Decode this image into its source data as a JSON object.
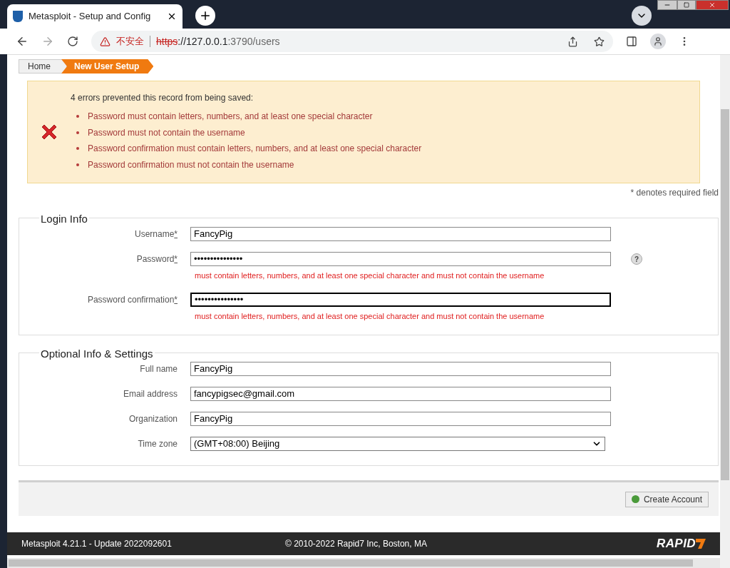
{
  "browser": {
    "tab_title": "Metasploit - Setup and Config",
    "url_warning": "不安全",
    "url_scheme": "https",
    "url_host": "://127.0.0.1",
    "url_path": ":3790/users"
  },
  "breadcrumbs": [
    {
      "label": "Home",
      "selected": false
    },
    {
      "label": "New User Setup",
      "selected": true
    }
  ],
  "error_box": {
    "heading": "4 errors prevented this record from being saved:",
    "errors": [
      "Password must contain letters, numbers, and at least one special character",
      "Password must not contain the username",
      "Password confirmation must contain letters, numbers, and at least one special character",
      "Password confirmation must not contain the username"
    ]
  },
  "required_note": "* denotes required field",
  "sections": [
    {
      "title": "Login Info",
      "fields": [
        {
          "label": "Username",
          "required": "*",
          "value": "FancyPig",
          "kind": "text"
        },
        {
          "label": "Password",
          "required": "*",
          "value": "•••••••••••••••",
          "kind": "text",
          "help": "?",
          "error": "must contain letters, numbers, and at least one special character and must not contain the username"
        },
        {
          "label": "Password confirmation",
          "required": "*",
          "value": "•••••••••••••••",
          "kind": "text",
          "focused": true,
          "error": "must contain letters, numbers, and at least one special character and must not contain the username"
        }
      ]
    },
    {
      "title": "Optional Info & Settings",
      "fields": [
        {
          "label": "Full name",
          "value": "FancyPig",
          "kind": "text"
        },
        {
          "label": "Email address",
          "value": "fancypigsec@gmail.com",
          "kind": "text"
        },
        {
          "label": "Organization",
          "value": "FancyPig",
          "kind": "text"
        },
        {
          "label": "Time zone",
          "value": "(GMT+08:00) Beijing",
          "kind": "select"
        }
      ]
    }
  ],
  "submit": "Create Account",
  "footer": {
    "version": "Metasploit 4.21.1 - Update 2022092601",
    "copyright": "© 2010-2022 Rapid7 Inc, Boston, MA",
    "logo": "RAPID"
  }
}
